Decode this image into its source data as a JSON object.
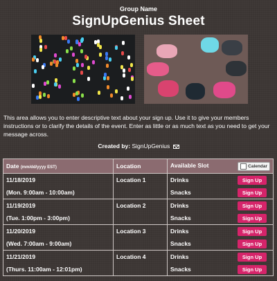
{
  "header": {
    "group_name": "Group Name",
    "title": "SignUpGenius Sheet"
  },
  "description": "This area allows you to enter descriptive text about your sign up. Use it to give your members instructions or to clarify the details of the event. Enter as little or as much text as you need to get your message across.",
  "created_by": {
    "label": "Created by:",
    "name": "SignUpGenius"
  },
  "table": {
    "headers": {
      "date": "Date",
      "date_hint": "(mm/dd/yyyy EST)",
      "location": "Location",
      "slot": "Available Slot",
      "calendar": "Calendar"
    },
    "rows": [
      {
        "date": "11/18/2019",
        "time": "(Mon. 9:00am - 10:00am)",
        "location": "Location 1",
        "slots": [
          "Drinks",
          "Snacks"
        ],
        "button": "Sign Up"
      },
      {
        "date": "11/19/2019",
        "time": "(Tue. 1:00pm - 3:00pm)",
        "location": "Location 2",
        "slots": [
          "Drinks",
          "Snacks"
        ],
        "button": "Sign Up"
      },
      {
        "date": "11/20/2019",
        "time": "(Wed. 7:00am - 9:00am)",
        "location": "Location 3",
        "slots": [
          "Drinks",
          "Snacks"
        ],
        "button": "Sign Up"
      },
      {
        "date": "11/21/2019",
        "time": "(Thurs. 11:00am - 12:01pm)",
        "location": "Location 4",
        "slots": [
          "Drinks",
          "Snacks"
        ],
        "button": "Sign Up"
      }
    ]
  },
  "colors": {
    "background": "#3b3533",
    "header_row": "#8b6b70",
    "signup_button": "#d6246a"
  }
}
